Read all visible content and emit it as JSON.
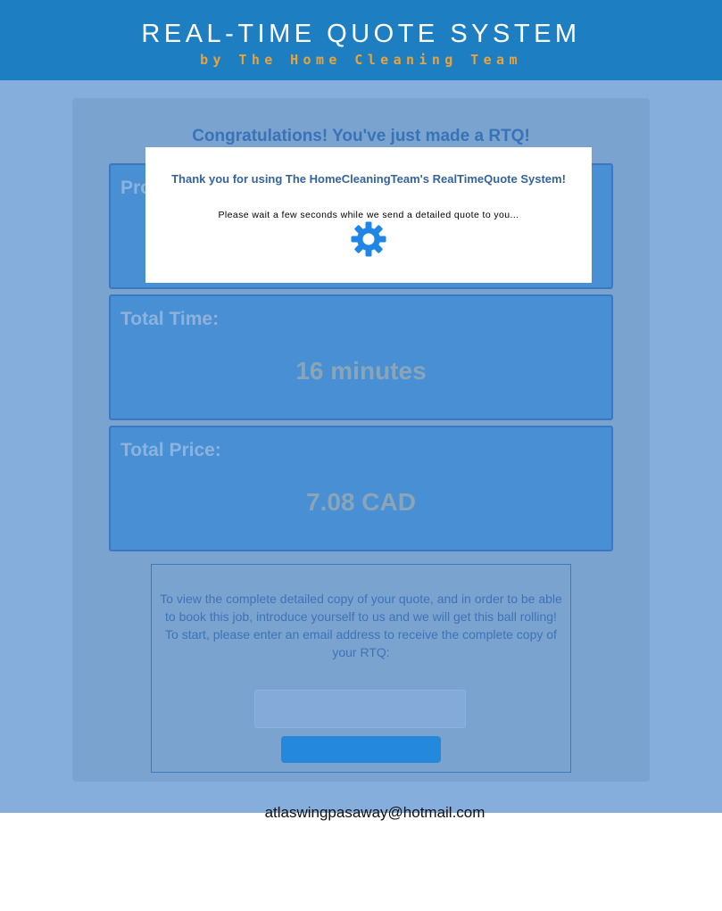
{
  "header": {
    "title": "REAL-TIME QUOTE SYSTEM",
    "subtitle": "by The Home Cleaning Team"
  },
  "congrats": "Congratulations! You've just made a RTQ!",
  "boxes": {
    "products": {
      "label": "Products:"
    },
    "time": {
      "label": "Total Time:",
      "value": "16 minutes"
    },
    "price": {
      "label": "Total Price:",
      "value": "7.08 CAD"
    }
  },
  "email_section": {
    "line1": "To view the complete detailed copy of your quote, and in order to be able",
    "line2": "to book this job, introduce yourself to us and we will get this ball rolling!",
    "line3": "To start, please enter an email address to receive the complete copy of your RTQ:",
    "input_value": "",
    "button_label": ""
  },
  "footer_email": "atlaswingpasaway@hotmail.com",
  "modal": {
    "title": "Thank you for using The HomeCleaningTeam's RealTimeQuote System!",
    "wait": "Please wait a few seconds while we send a detailed quote to you...",
    "icon": "gear-icon"
  },
  "colors": {
    "header_bg": "#1d7fc1",
    "accent_orange": "#e9a33a",
    "box_bg": "#4890d3",
    "button_bg": "#2488dc"
  }
}
